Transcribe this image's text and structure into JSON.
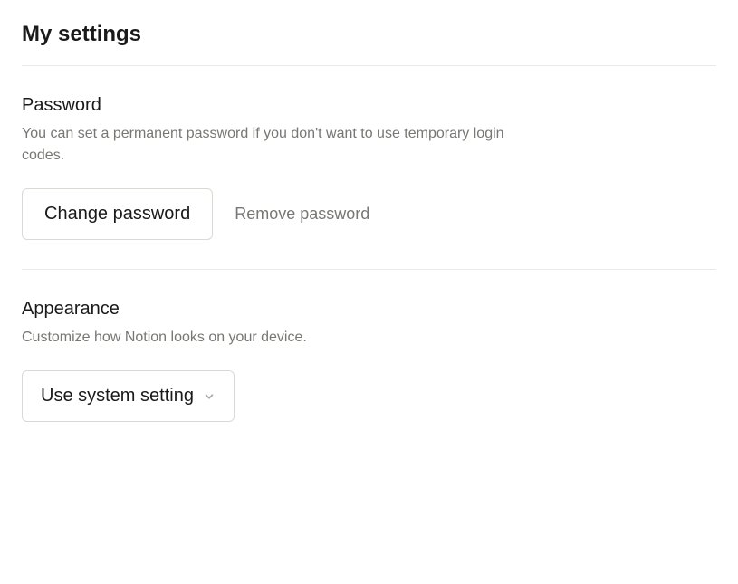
{
  "page": {
    "title": "My settings"
  },
  "sections": {
    "password": {
      "title": "Password",
      "description": "You can set a permanent password if you don't want to use temporary login codes.",
      "change_label": "Change password",
      "remove_label": "Remove password"
    },
    "appearance": {
      "title": "Appearance",
      "description": "Customize how Notion looks on your device.",
      "selected": "Use system setting"
    }
  }
}
